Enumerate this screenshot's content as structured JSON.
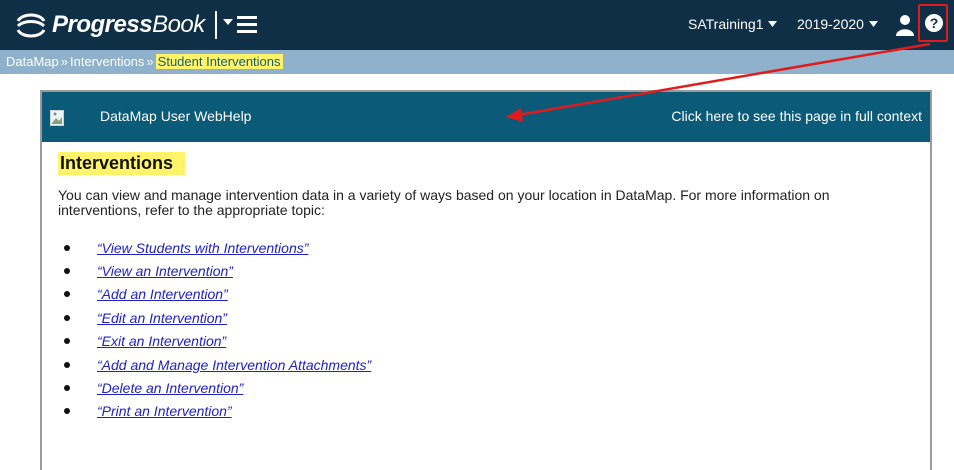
{
  "app": {
    "logo_text_bold": "Progress",
    "logo_text_rest": "Book",
    "logo_icon": "progressbook-swirl-icon",
    "user": "SATraining1",
    "year": "2019-2020",
    "help_icon": "help-icon",
    "person_icon": "user-icon"
  },
  "breadcrumb": {
    "items": [
      "DataMap",
      "Interventions"
    ],
    "separator": "»",
    "current": "Student Interventions"
  },
  "help_panel": {
    "title": "DataMap User WebHelp",
    "context_link": "Click here to see this page in full context",
    "heading": "Interventions",
    "intro": "You can view and manage intervention data in a variety of ways based on your location in DataMap. For more information on interventions, refer to the appropriate topic:",
    "links": [
      "“View Students with Interventions”",
      "“View an Intervention”",
      "“Add an Intervention”",
      "“Edit an Intervention”",
      "“Exit an Intervention”",
      "“Add and Manage Intervention Attachments”",
      "“Delete an Intervention”",
      "“Print an Intervention”"
    ]
  },
  "colors": {
    "topbar": "#0f2f47",
    "crumbbar": "#8fb1cc",
    "panel_header": "#0b5a78",
    "highlight": "#fff36a",
    "callout": "#e11b1b",
    "link": "#2121c8"
  }
}
